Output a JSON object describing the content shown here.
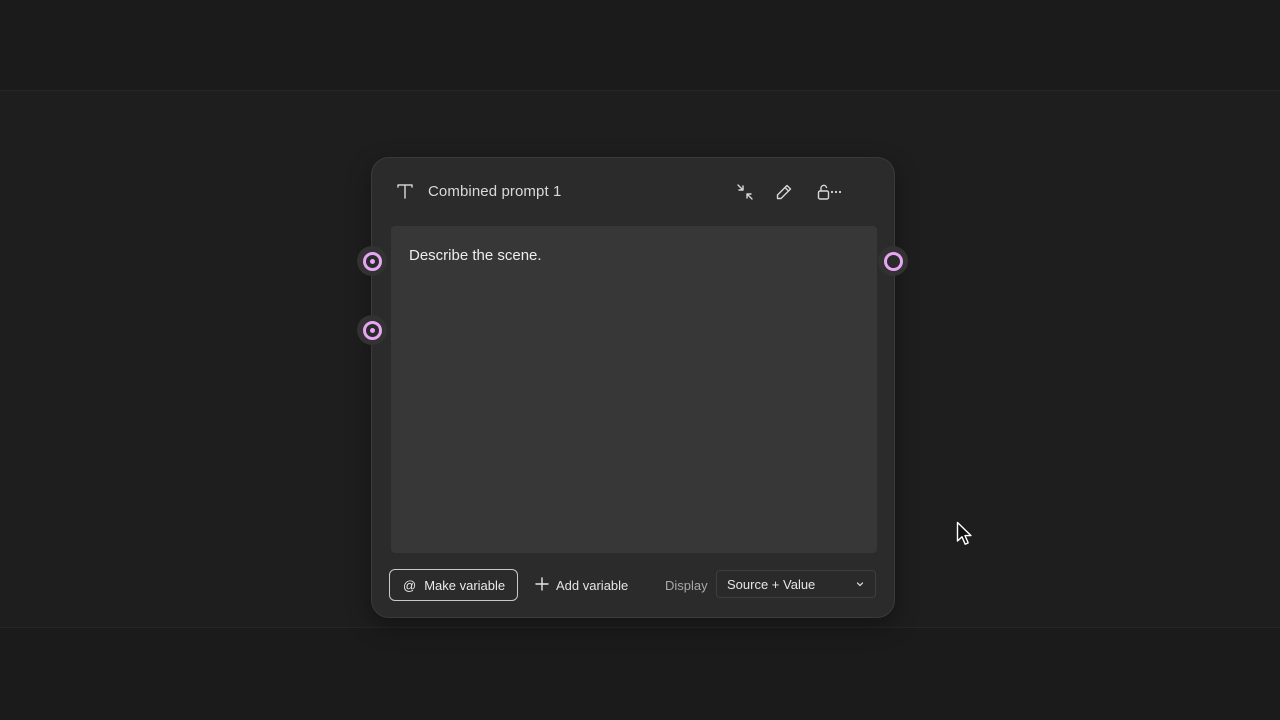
{
  "node": {
    "title": "Combined prompt 1",
    "type_icon": "text-type-icon",
    "header_actions": [
      "collapse-icon",
      "pencil-icon",
      "unlock-icon",
      "more-icon"
    ],
    "content": "Describe the scene."
  },
  "footer": {
    "make_variable_symbol": "@",
    "make_variable_label": "Make variable",
    "add_variable_label": "Add variable",
    "display_label": "Display",
    "display_value": "Source + Value"
  },
  "colors": {
    "port_accent": "#e6a6f2",
    "background": "#1b1b1b",
    "node_bg": "#2b2b2b",
    "editor_bg": "#373737"
  }
}
